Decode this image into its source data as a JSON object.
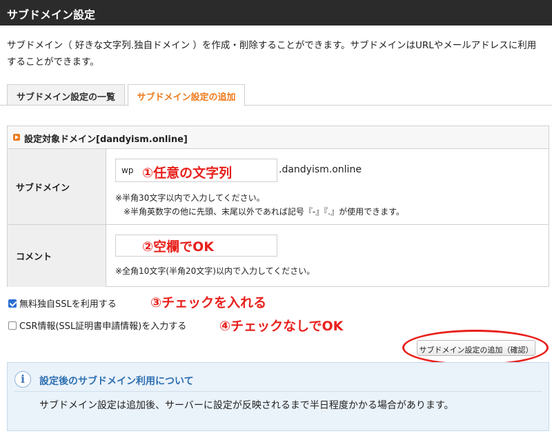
{
  "header": {
    "title": "サブドメイン設定"
  },
  "description": "サブドメイン（ 好きな文字列.独自ドメイン ）を作成・削除することができます。サブドメインはURLやメールアドレスに利用することができます。",
  "tabs": [
    {
      "label": "サブドメイン設定の一覧",
      "active": false
    },
    {
      "label": "サブドメイン設定の追加",
      "active": true
    }
  ],
  "section": {
    "title": "設定対象ドメイン[dandyism.online]"
  },
  "form": {
    "subdomain": {
      "label": "サブドメイン",
      "value": "wp",
      "suffix": ".dandyism.online",
      "note1": "※半角30文字以内で入力してください。",
      "note2": "※半角英数字の他に先頭、末尾以外であれば記号『-』『.』が使用できます。"
    },
    "comment": {
      "label": "コメント",
      "value": "",
      "note": "※全角10文字(半角20文字)以内で入力してください。"
    }
  },
  "options": {
    "ssl": {
      "label": "無料独自SSLを利用する",
      "checked": true
    },
    "csr": {
      "label": "CSR情報(SSL証明書申請情報)を入力する",
      "checked": false
    }
  },
  "annotations": {
    "a1": "①任意の文字列",
    "a2": "②空欄でOK",
    "a3": "③チェックを入れる",
    "a4": "④チェックなしでOK"
  },
  "confirm_button": "サブドメイン設定の追加（確認）",
  "info": {
    "title": "設定後のサブドメイン利用について",
    "text": "サブドメイン設定は追加後、サーバーに設定が反映されるまで半日程度かかる場合があります。"
  },
  "colors": {
    "accent_orange": "#ee7b1c",
    "annotation_red": "#e8201c",
    "info_blue": "#2c6fb0",
    "header_bg": "#2b2b2b"
  }
}
